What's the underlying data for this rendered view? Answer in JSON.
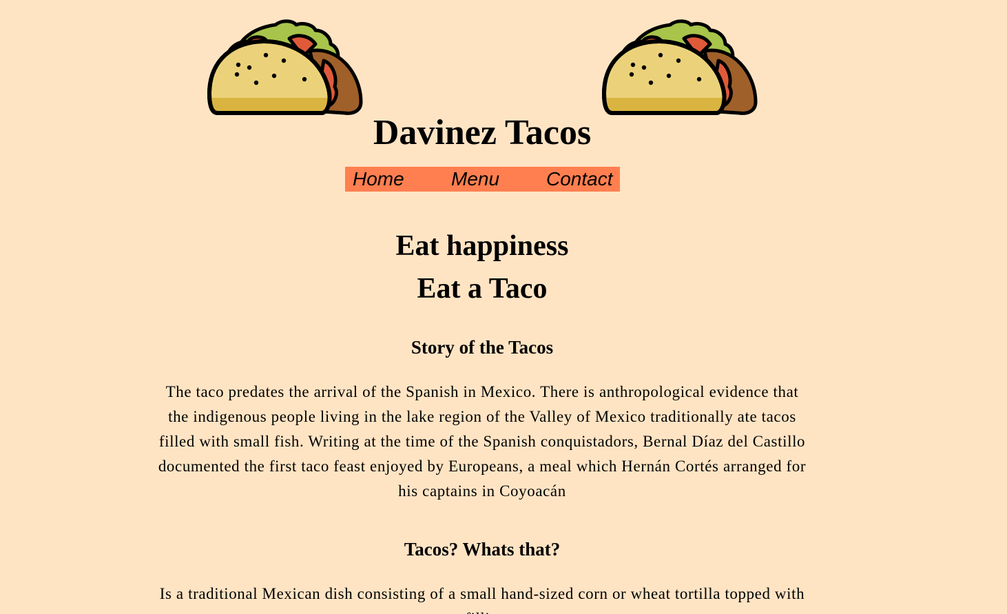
{
  "header": {
    "logo_icon": "taco-icon",
    "title": "Davinez Tacos"
  },
  "nav": {
    "items": [
      {
        "label": "Home"
      },
      {
        "label": "Menu"
      },
      {
        "label": "Contact"
      }
    ],
    "background": "#ff7f50"
  },
  "hero": {
    "line1": "Eat happiness",
    "line2": "Eat a Taco"
  },
  "sections": [
    {
      "heading": "Story of the Tacos",
      "text": "The taco predates the arrival of the Spanish in Mexico. There is anthropological evidence that the indigenous people living in the lake region of the Valley of Mexico traditionally ate tacos filled with small fish. Writing at the time of the Spanish conquistadors, Bernal Díaz del Castillo documented the first taco feast enjoyed by Europeans, a meal which Hernán Cortés arranged for his captains in Coyoacán"
    },
    {
      "heading": "Tacos? Whats that?",
      "text": "Is a traditional Mexican dish consisting of a small hand-sized corn or wheat tortilla topped with a filling."
    }
  ],
  "colors": {
    "page_background": "#ffe4c4",
    "nav_background": "#ff7f50"
  }
}
